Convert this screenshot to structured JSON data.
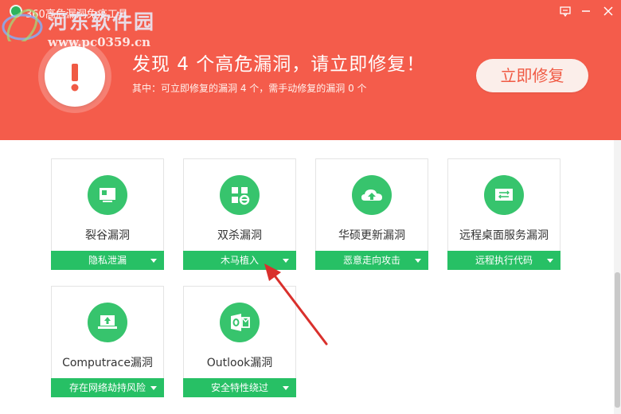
{
  "window": {
    "title": "360高危漏洞免疫工具",
    "feedback_icon": "feedback-icon",
    "minimize_icon": "minimize-icon",
    "close_icon": "close-icon"
  },
  "watermark": {
    "name": "河东软件园",
    "url": "www.pc0359.cn"
  },
  "alert": {
    "title": "发现 4 个高危漏洞，请立即修复！",
    "subtitle": "其中：可立即修复的漏洞 4 个，需手动修复的漏洞 0 个",
    "fix_button": "立即修复",
    "icon": "warning-icon"
  },
  "cards": [
    {
      "name": "裂谷漏洞",
      "tag": "隐私泄漏",
      "icon": "monitor-icon"
    },
    {
      "name": "双杀漏洞",
      "tag": "木马植入",
      "icon": "browser-e-icon"
    },
    {
      "name": "华硕更新漏洞",
      "tag": "恶意走向攻击",
      "icon": "cloud-upload-icon"
    },
    {
      "name": "远程桌面服务漏洞",
      "tag": "远程执行代码",
      "icon": "remote-desktop-icon"
    },
    {
      "name": "Computrace漏洞",
      "tag": "存在网络劫持风险",
      "icon": "laptop-upload-icon"
    },
    {
      "name": "Outlook漏洞",
      "tag": "安全特性绕过",
      "icon": "outlook-icon"
    }
  ],
  "colors": {
    "header": "#f45c4b",
    "card_icon": "#37c46d",
    "card_tag": "#27c065",
    "annotation_arrow": "#d9302c"
  }
}
